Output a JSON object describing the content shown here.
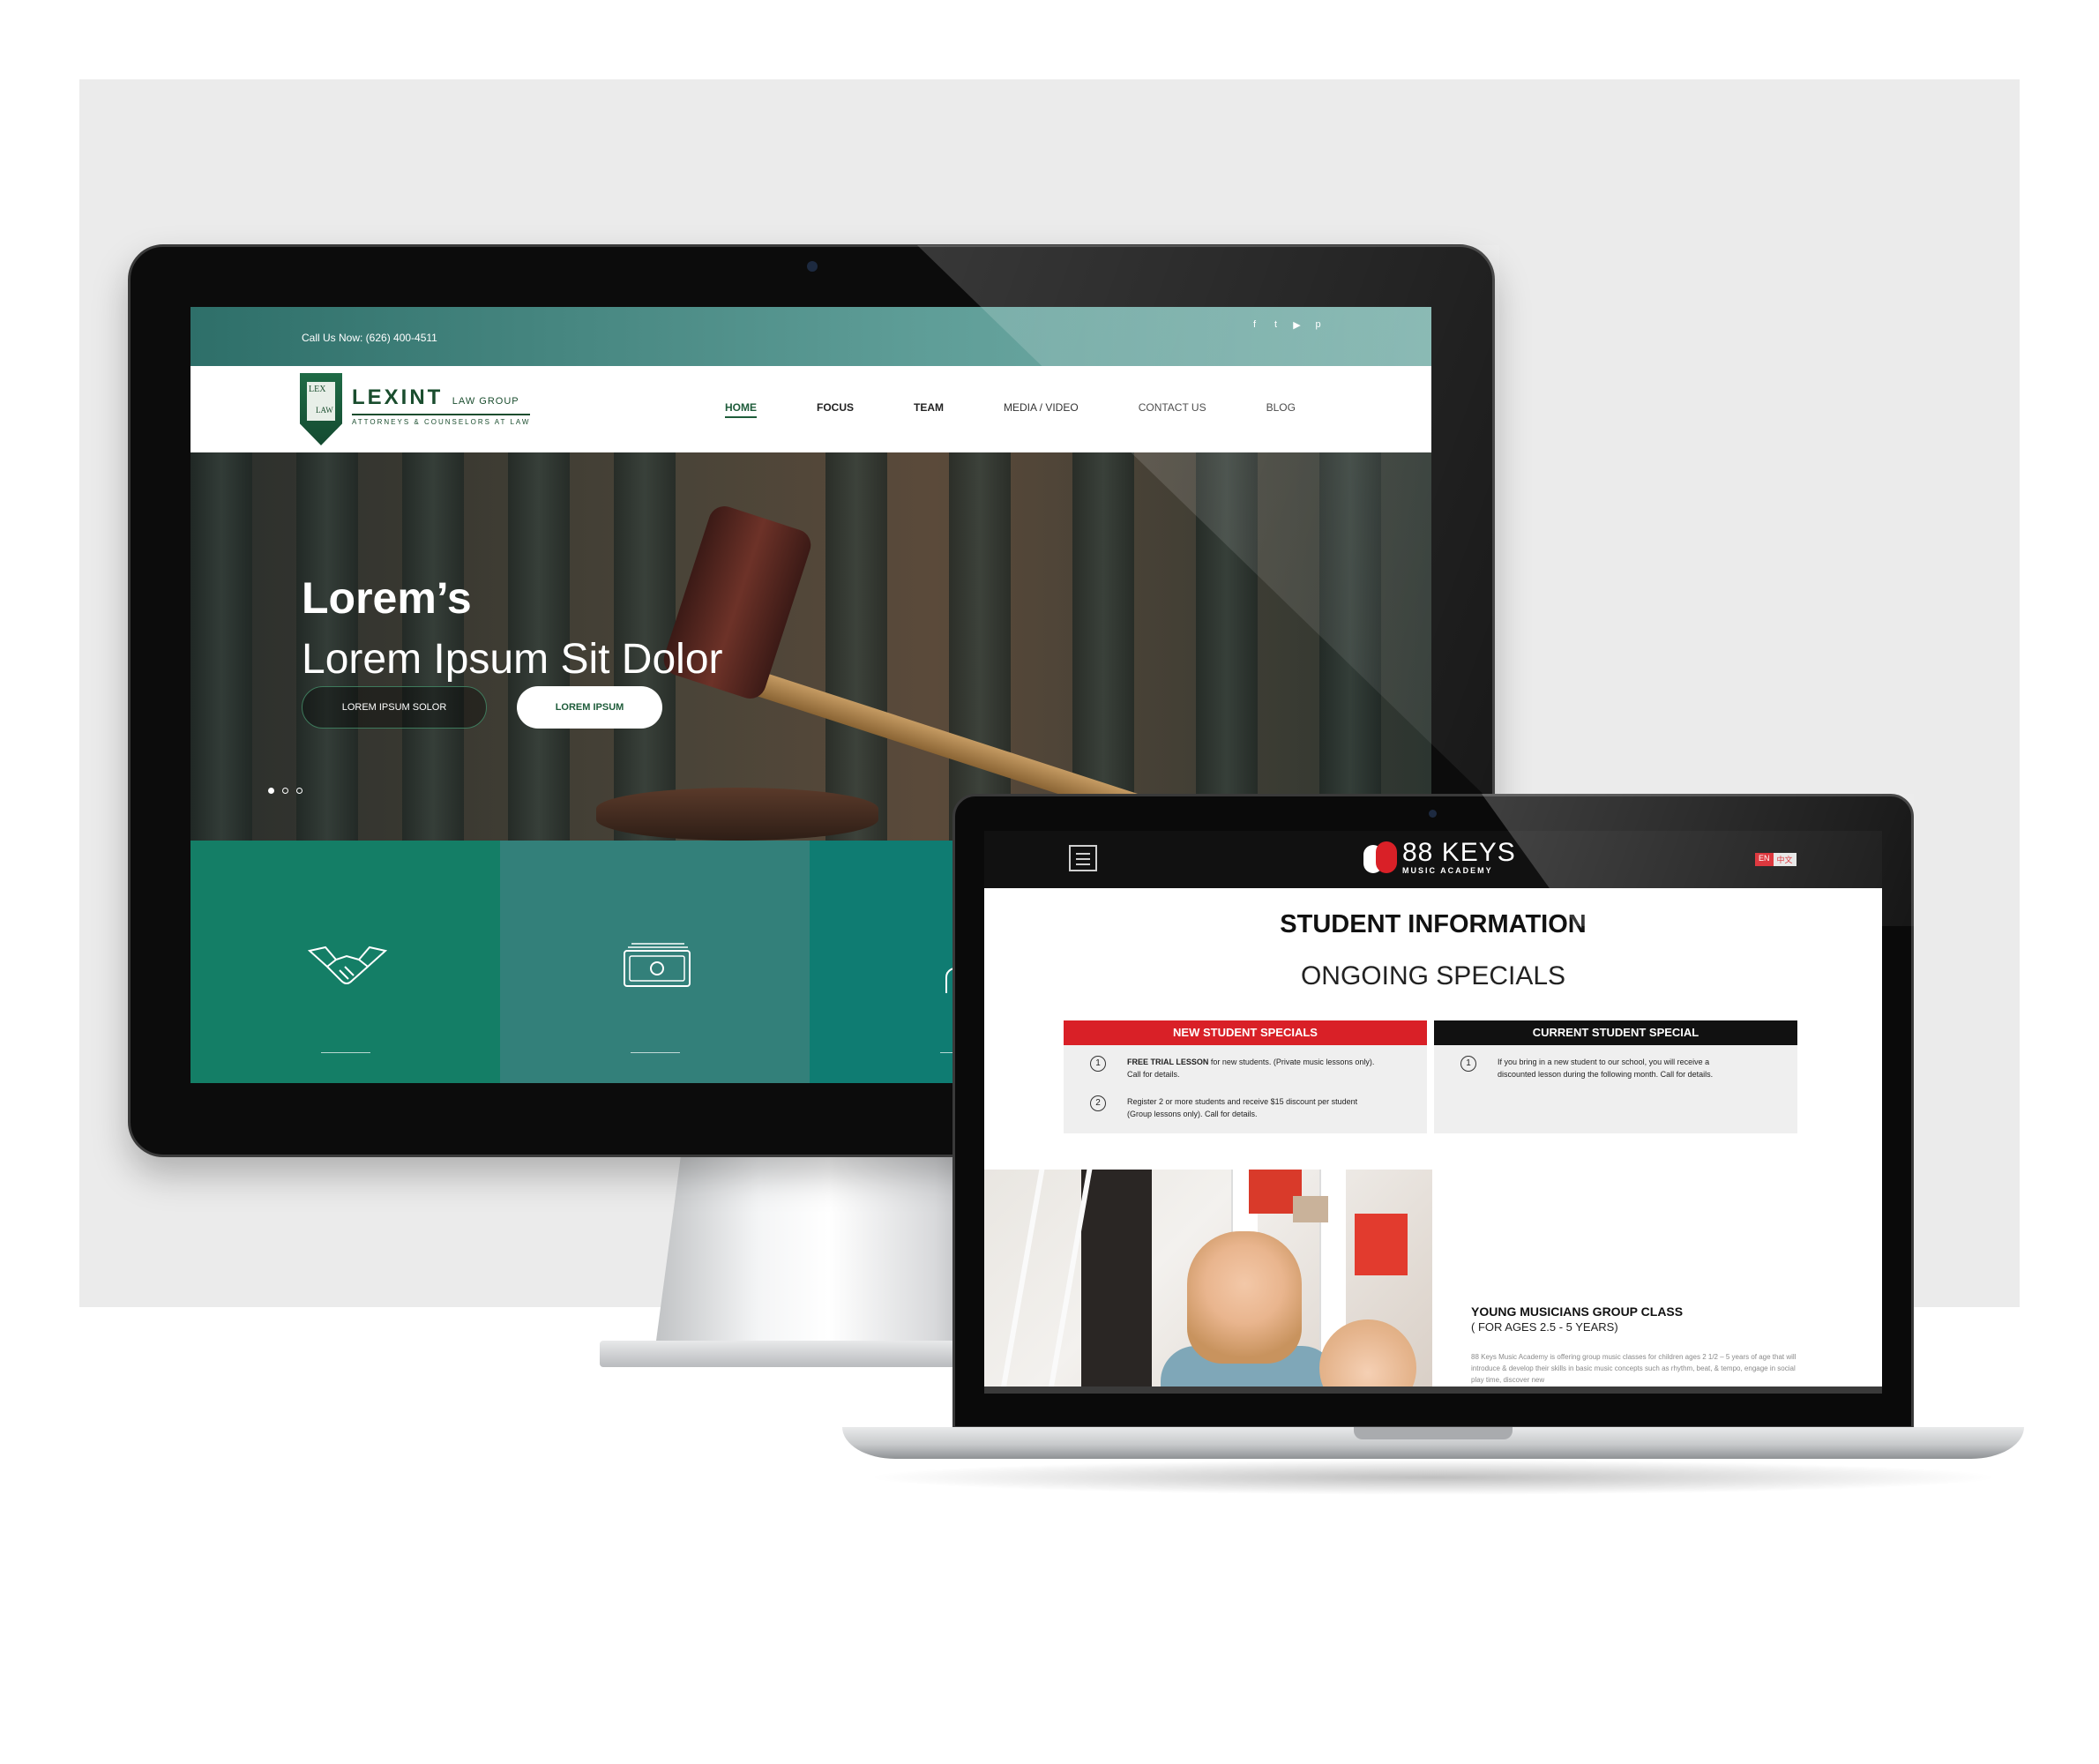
{
  "lexint": {
    "topbar": {
      "phone": "Call Us Now: (626) 400-4511",
      "social": [
        {
          "icon": "facebook-icon",
          "glyph": "f"
        },
        {
          "icon": "twitter-icon",
          "glyph": "t"
        },
        {
          "icon": "youtube-icon",
          "glyph": "▶"
        },
        {
          "icon": "pinterest-icon",
          "glyph": "p"
        }
      ]
    },
    "brand": {
      "name": "LEXINT",
      "suffix": "LAW GROUP",
      "tagline": "ATTORNEYS & COUNSELORS AT LAW",
      "shield_lex": "LEX",
      "shield_law": "LAW"
    },
    "nav": {
      "home": "HOME",
      "focus": "FOCUS",
      "team": "TEAM",
      "media": "MEDIA / VIDEO",
      "contact": "CONTACT US",
      "blog": "BLOG"
    },
    "hero": {
      "line1": "Lorem’s",
      "line2": "Lorem Ipsum Sit Dolor",
      "button_outline": "LOREM IPSUM SOLOR",
      "button_solid": "LOREM IPSUM",
      "slide_count": 3,
      "active_slide": 1
    },
    "tiles": [
      {
        "icon": "handshake-icon",
        "color": "#147e66"
      },
      {
        "icon": "money-icon",
        "color": "#33807a"
      },
      {
        "icon": "person-icon",
        "color": "#0f7c72"
      }
    ],
    "colors": {
      "brand_green": "#1e5c3a",
      "topbar": "#2e6f69"
    }
  },
  "keys88": {
    "header": {
      "logo_text": "88 KEYS",
      "logo_sub": "MUSIC ACADEMY",
      "lang_en": "EN",
      "lang_zh": "中文"
    },
    "title": "STUDENT INFORMATION",
    "subtitle": "ONGOING SPECIALS",
    "new_specials": {
      "heading": "NEW STUDENT SPECIALS",
      "item1_num": "1",
      "item1_bold": "FREE TRIAL LESSON",
      "item1_rest": " for new students. (Private music lessons only).",
      "item1_line2": "Call for details.",
      "item2_num": "2",
      "item2_line1": "Register 2 or more students and receive $15 discount per student",
      "item2_line2": "(Group lessons only). Call for details."
    },
    "current_specials": {
      "heading": "CURRENT STUDENT SPECIAL",
      "item1_num": "1",
      "item1_line1": "If you bring in a new student to our school, you will receive a",
      "item1_line2": "discounted lesson during the following month. Call for details."
    },
    "section": {
      "title": "YOUNG MUSICIANS GROUP CLASS",
      "subtitle": "( FOR AGES 2.5 - 5 YEARS)",
      "body": "88 Keys Music Academy is offering group music classes for children ages 2 1/2 – 5 years of age that will introduce & develop their skills in basic music concepts such as rhythm, beat, & tempo, engage in social play time, discover new"
    },
    "colors": {
      "red": "#d92027",
      "black": "#111111"
    }
  }
}
